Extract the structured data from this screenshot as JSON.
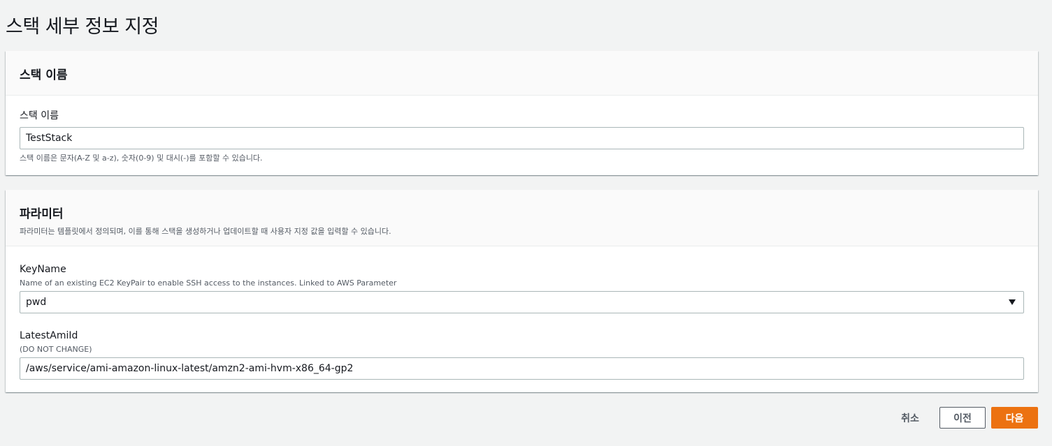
{
  "page": {
    "title": "스택 세부 정보 지정"
  },
  "stack_name_section": {
    "title": "스택 이름",
    "field_label": "스택 이름",
    "value": "TestStack",
    "hint": "스택 이름은 문자(A-Z 및 a-z), 숫자(0-9) 및 대시(-)를 포함할 수 있습니다."
  },
  "parameters_section": {
    "title": "파라미터",
    "description": "파라미터는 템플릿에서 정의되며, 이를 통해 스택을 생성하거나 업데이트할 때 사용자 지정 값을 입력할 수 있습니다.",
    "key_name": {
      "label": "KeyName",
      "description": "Name of an existing EC2 KeyPair to enable SSH access to the instances. Linked to AWS Parameter",
      "selected": "pwd"
    },
    "latest_ami_id": {
      "label": "LatestAmiId",
      "description": "(DO NOT CHANGE)",
      "value": "/aws/service/ami-amazon-linux-latest/amzn2-ami-hvm-x86_64-gp2"
    }
  },
  "footer": {
    "cancel_label": "취소",
    "previous_label": "이전",
    "next_label": "다음"
  },
  "colors": {
    "primary": "#ec7211",
    "background": "#f2f3f3",
    "border": "#aab7b8"
  }
}
